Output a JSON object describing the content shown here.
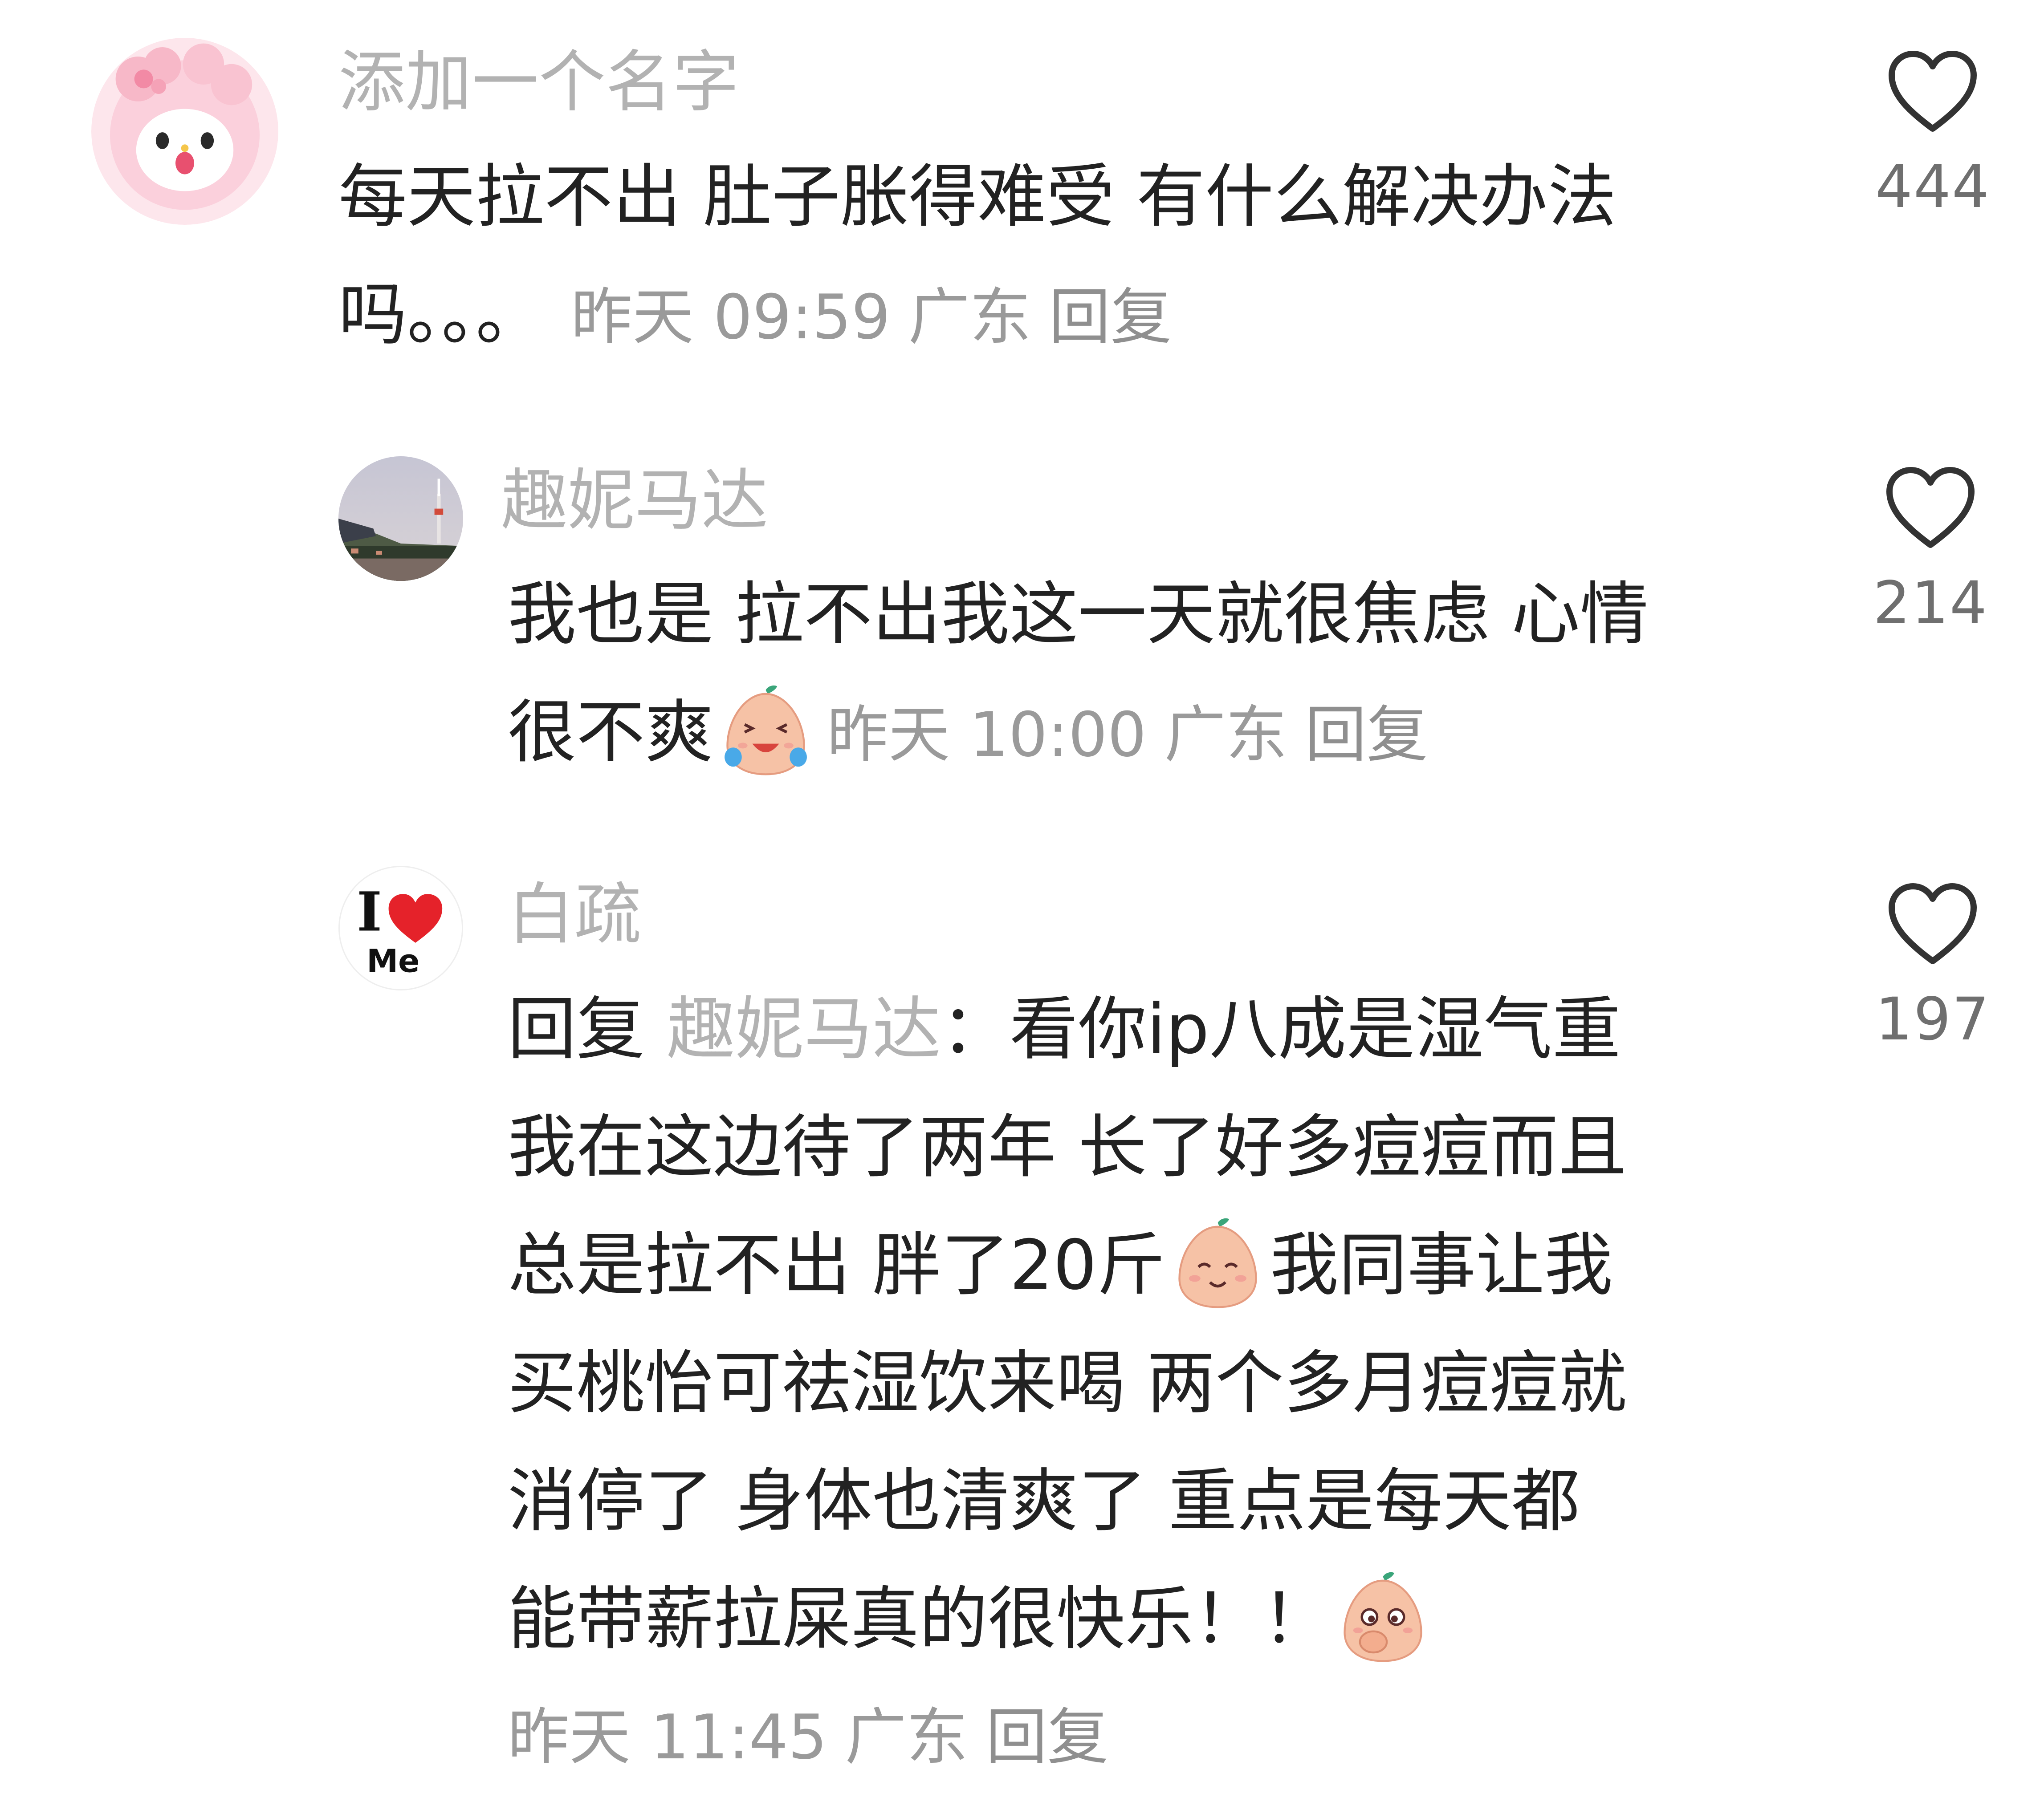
{
  "comments": [
    {
      "username": "添加一个名字",
      "avatar_icon": "pink-sheep-avatar-icon",
      "lines": [
        "每天拉不出 肚子胀得难受 有什么解决办法",
        "吗。。。"
      ],
      "time": "昨天 09:59",
      "location": "广东",
      "reply_label": "回复",
      "likes": "444",
      "like_icon": "heart-outline-icon"
    },
    {
      "username": "趣妮马达",
      "avatar_icon": "city-tower-photo-avatar-icon",
      "lines": [
        "我也是 拉不出我这一天就很焦虑 心情",
        "很不爽"
      ],
      "emoji_icon": "crying-laughing-peach-emoji-icon",
      "time": "昨天 10:00",
      "location": "广东",
      "reply_label": "回复",
      "likes": "214",
      "like_icon": "heart-outline-icon"
    },
    {
      "username": "白疏",
      "avatar_icon": "i-love-me-avatar-icon",
      "avatar_text_top": "I",
      "avatar_text_bottom": "Me",
      "reply_prefix": "回复",
      "reply_to": "趣妮马达",
      "reply_colon": "：",
      "line1_rest": "看你ip八成是湿气重",
      "line2": "我在这边待了两年 长了好多痘痘而且",
      "line3a": "总是拉不出 胖了20斤",
      "line3b": "我同事让我",
      "line4": "买桃怡可祛湿饮来喝 两个多月痘痘就",
      "line5": "消停了 身体也清爽了 重点是每天都",
      "line6": "能带薪拉屎真的很快乐！！",
      "emoji_smile_icon": "smiling-peach-emoji-icon",
      "emoji_shy_icon": "shy-covering-mouth-peach-emoji-icon",
      "time": "昨天 11:45",
      "location": "广东",
      "reply_label": "回复",
      "likes": "197",
      "like_icon": "heart-outline-icon"
    }
  ],
  "colors": {
    "username": "#b2b2b2",
    "body_text": "#222222",
    "meta": "#9a9a9a",
    "like_count": "#6f6f6f",
    "heart_stroke": "#333333",
    "avatar_heart": "#e5222a"
  }
}
